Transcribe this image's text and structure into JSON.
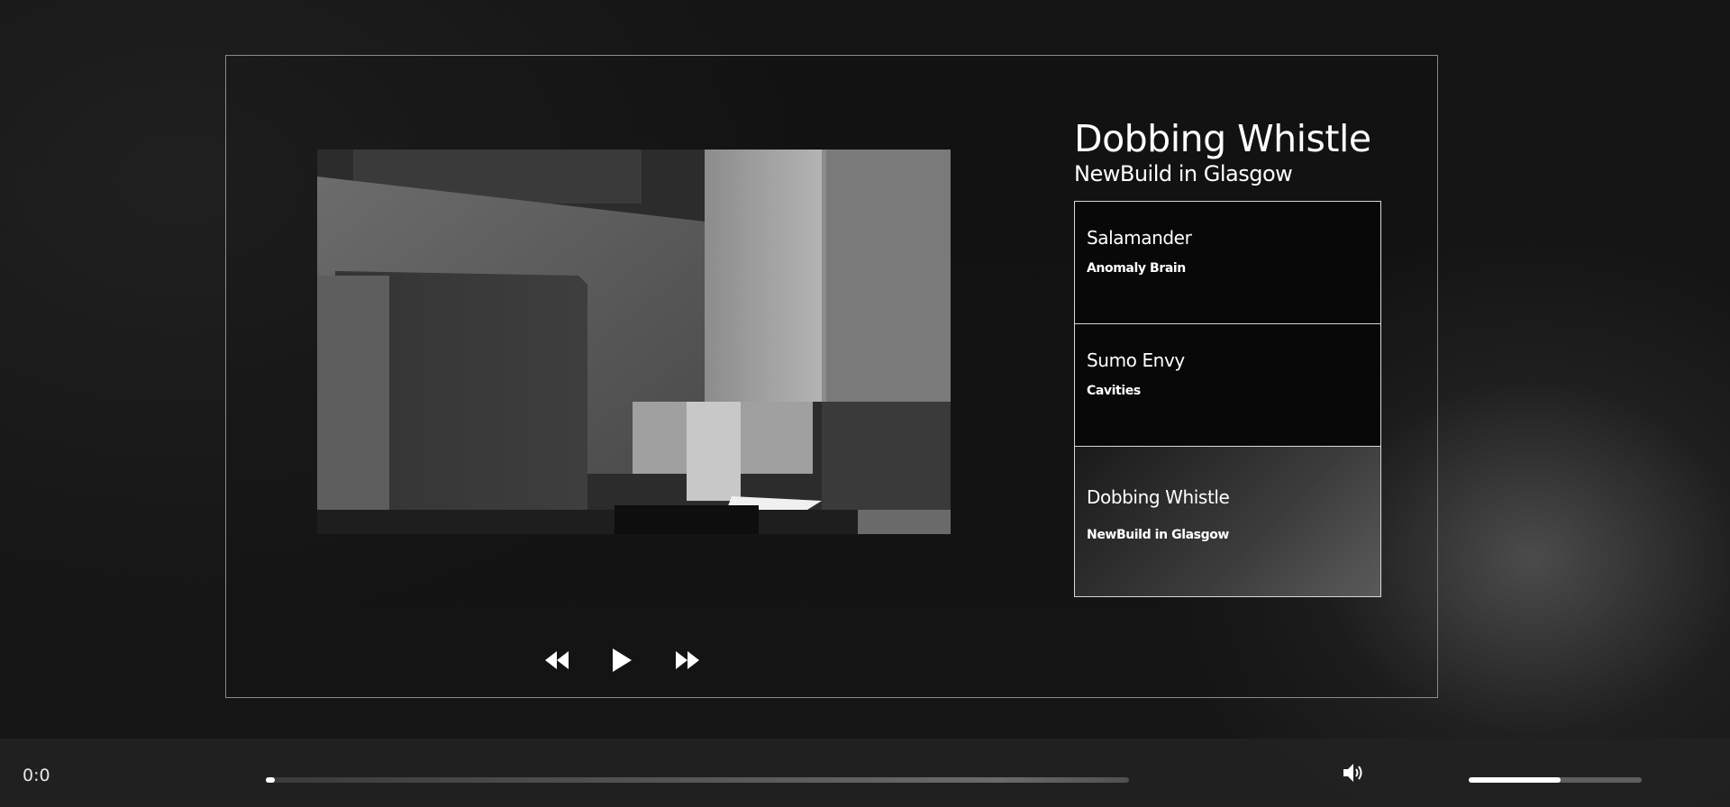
{
  "player": {
    "now_playing": {
      "title": "Dobbing Whistle",
      "artist": "NewBuild in Glasgow"
    },
    "controls": {
      "previous_icon": "rewind-icon",
      "play_icon": "play-icon",
      "next_icon": "fast-forward-icon"
    },
    "playlist": [
      {
        "name": "Salamander",
        "artist": "Anomaly Brain",
        "active": false
      },
      {
        "name": "Sumo Envy",
        "artist": "Cavities",
        "active": false
      },
      {
        "name": "Dobbing Whistle",
        "artist": "NewBuild in Glasgow",
        "active": true
      }
    ]
  },
  "bottom_bar": {
    "time": "0:0",
    "progress": 0.01,
    "volume_icon": "speaker-icon",
    "volume": 0.53
  },
  "colors": {
    "background": "#121212",
    "frame_border": "#8a8a8a",
    "active_track": "#3c3c3c",
    "text": "#ffffff"
  }
}
